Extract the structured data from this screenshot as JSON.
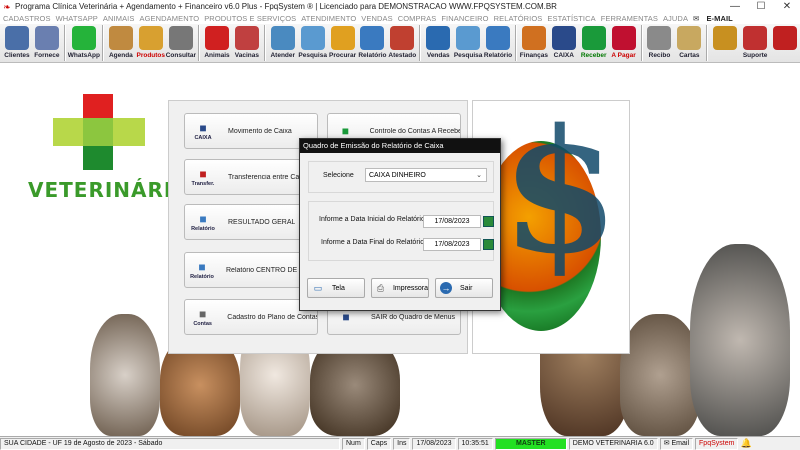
{
  "window": {
    "title": "Programa Clínica Veterinária + Agendamento + Financeiro v6.0 Plus - FpqSystem ® | Licenciado para  DEMONSTRACAO WWW.FPQSYSTEM.COM.BR",
    "min": "—",
    "max": "☐",
    "close": "✕"
  },
  "menu": [
    "CADASTROS",
    "WHATSAPP",
    "ANIMAIS",
    "AGENDAMENTO",
    "PRODUTOS E SERVIÇOS",
    "ATENDIMENTO",
    "VENDAS",
    "COMPRAS",
    "FINANCEIRO",
    "RELATÓRIOS",
    "ESTATÍSTICA",
    "FERRAMENTAS",
    "AJUDA",
    "E-MAIL"
  ],
  "toolbar": [
    {
      "label": "Clientes",
      "icon": "people-icon",
      "color": "#4a6fa8"
    },
    {
      "label": "Fornece",
      "icon": "supplier-icon",
      "color": "#6a7fb0"
    },
    {
      "label": "WhatsApp",
      "icon": "whatsapp-icon",
      "color": "#25b33a"
    },
    {
      "label": "Agenda",
      "icon": "calendar-icon",
      "color": "#c08a40"
    },
    {
      "label": "Produtos",
      "icon": "boxes-icon",
      "color": "#d8a030",
      "labelColor": "red"
    },
    {
      "label": "Consultar",
      "icon": "register-icon",
      "color": "#777777"
    },
    {
      "label": "Animais",
      "icon": "paw-icon",
      "color": "#d02020"
    },
    {
      "label": "Vacinas",
      "icon": "syringe-icon",
      "color": "#c04040"
    },
    {
      "label": "Atender",
      "icon": "medical-icon",
      "color": "#4a8ac0"
    },
    {
      "label": "Pesquisa",
      "icon": "search-doc-icon",
      "color": "#5a9ad0"
    },
    {
      "label": "Procurar",
      "icon": "folder-icon",
      "color": "#e0a020"
    },
    {
      "label": "Relatório",
      "icon": "report-icon",
      "color": "#3a7ac0"
    },
    {
      "label": "Atestado",
      "icon": "certificate-icon",
      "color": "#c04030"
    },
    {
      "label": "Vendas",
      "icon": "monitor-icon",
      "color": "#2a6ab0"
    },
    {
      "label": "Pesquisa",
      "icon": "search-doc-icon",
      "color": "#5a9ad0"
    },
    {
      "label": "Relatório",
      "icon": "report-icon",
      "color": "#3a7ac0"
    },
    {
      "label": "Finanças",
      "icon": "finance-icon",
      "color": "#d07020"
    },
    {
      "label": "CAIXA",
      "icon": "cash-icon",
      "color": "#2a4a8a"
    },
    {
      "label": "Receber",
      "icon": "dollar-green-icon",
      "color": "#1a9a3a",
      "labelColor": "green"
    },
    {
      "label": "A Pagar",
      "icon": "dollar-red-icon",
      "color": "#c01030",
      "labelColor": "red"
    },
    {
      "label": "Recibo",
      "icon": "receipt-icon",
      "color": "#8a8a8a"
    },
    {
      "label": "Cartas",
      "icon": "scroll-icon",
      "color": "#c8a860"
    },
    {
      "label": "",
      "icon": "coins-icon",
      "color": "#c89020"
    },
    {
      "label": "Suporte",
      "icon": "support-icon",
      "color": "#c03030"
    },
    {
      "label": "",
      "icon": "exit-icon",
      "color": "#c02020"
    }
  ],
  "logo_text": "VETERINÁRIA",
  "menu_buttons": [
    {
      "label": "Movimento de Caixa",
      "icon_caption": "CAIXA",
      "icon": "cash-icon"
    },
    {
      "label": "Controle do Contas A Receber",
      "icon_caption": "",
      "icon": "dollar-green-icon"
    },
    {
      "label": "Transferencia entre Caixa",
      "icon_caption": "Transfer.",
      "icon": "transfer-icon"
    },
    {
      "label": "RESULTADO GERAL",
      "icon_caption": "Relatório",
      "icon": "report-icon"
    },
    {
      "label": "Relatório CENTRO DE CUSTO",
      "icon_caption": "Relatório",
      "icon": "report-icon"
    },
    {
      "label": "Cadastro do Plano de Contas",
      "icon_caption": "Contas",
      "icon": "abc-icon"
    },
    {
      "label": "SAIR do Quadro de Menus",
      "icon_caption": "",
      "icon": "exit-icon"
    }
  ],
  "dialog": {
    "title": "Quadro de Emissão do Relatório de Caixa",
    "select_label": "Selecione",
    "select_value": "CAIXA DINHEIRO",
    "date_start_label": "Informe a Data Inicial do Relatório",
    "date_start": "17/08/2023",
    "date_end_label": "Informe a Data Final do Relatório",
    "date_end": "17/08/2023",
    "btn_screen": "Tela",
    "btn_print": "Impressora",
    "btn_exit": "Sair"
  },
  "status": {
    "city": "SUA CIDADE - UF 19 de Agosto de 2023 - Sábado",
    "num": "Num",
    "caps": "Caps",
    "ins": "Ins",
    "date": "17/08/2023",
    "time": "10:35:51",
    "master": "MASTER",
    "demo": "DEMO VETERINARIA 6.0",
    "email": "Email",
    "brand": "FpqSystem"
  }
}
